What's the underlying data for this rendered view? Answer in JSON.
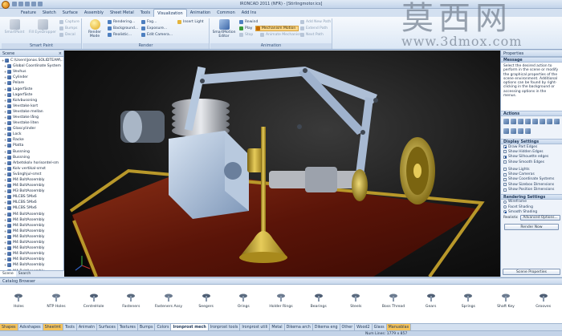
{
  "window": {
    "title": "IRONCAD 2011 (NFR) - [Stirlingmotor.ics]"
  },
  "tabs": [
    "Feature",
    "Sketch",
    "Surface",
    "Assembly",
    "Sheet Metal",
    "Tools",
    "Visualization",
    "Animation",
    "Common",
    "Add Ins"
  ],
  "active_tab": "Visualization",
  "ribbon": {
    "smart_paint": {
      "label": "Smart Paint",
      "smartpaint": "SmartPaint",
      "fill_eyedropper": "Fill EyeDropper",
      "capture": "Capture",
      "bumps": "Bumps",
      "decal": "Decal"
    },
    "render": {
      "label": "Render",
      "render_mode": "Render Mode",
      "rendering": "Rendering...",
      "background": "Background...",
      "realistic": "Realistic...",
      "fog": "Fog...",
      "exposure": "Exposure...",
      "edit_camera": "Edit Camera...",
      "insert_light": "Insert Light"
    },
    "animation": {
      "label": "Animation",
      "smartmotion_editor": "SmartMotion Editor",
      "rewind": "Rewind",
      "play": "Play",
      "stop": "Stop",
      "mechanism_motion": "Mechanism Motion",
      "animate_mechanism": "Animate Mechanism",
      "add_new_path": "Add New Path",
      "extend_path": "Extend Path",
      "next_path": "Next Path"
    }
  },
  "watermark": {
    "chinese": "莫西网",
    "url": "www.3dmox.com"
  },
  "scene_browser": {
    "title": "Scene",
    "close": "×",
    "items": [
      "C:\\Users\\Jonas.SOLIDTEAM\\...",
      "Global Coordinate System",
      "Vevhus",
      "Cylinder",
      "Pelare",
      "Lagerfäste",
      "Lagerfäste",
      "Kolvbussning",
      "Vevstake kort",
      "Vevstake mellan",
      "Vevstake lång",
      "Vevstake liten",
      "Glascylinder",
      "Lock",
      "Racke",
      "Platta",
      "Bussning",
      "Bussning",
      "Arbetskolv horisontel-sm",
      "Kolv vertikal-smst",
      "Svänghjul-smst",
      "M4 BoltAssembly",
      "M4 BoltAssembly",
      "M3 BoltAssembly",
      "MLCBS 5Mx6",
      "MLCBS 5Mx6",
      "MLCBS 5Mx6",
      "M4 BoltAssembly",
      "M4 BoltAssembly",
      "M4 BoltAssembly",
      "M4 BoltAssembly",
      "M4 BoltAssembly",
      "M4 BoltAssembly",
      "M4 BoltAssembly",
      "M4 BoltAssembly",
      "M4 BoltAssembly",
      "M4 BoltAssembly",
      "M4 BoltAssembly"
    ],
    "bottom_tabs": [
      "Scene",
      "Search"
    ]
  },
  "properties": {
    "title": "Properties",
    "message_head": "Message",
    "message": "Select the desired action to perform in the scene or modify the graphical properties of the scene environment. Additional options can be found by right-clicking in the background or accessing options in the menus.",
    "actions_head": "Actions",
    "display_head": "Display Settings",
    "display": [
      {
        "label": "Draw Part Edges",
        "checked": true
      },
      {
        "label": "Show Hidden Edges",
        "checked": false
      },
      {
        "label": "Show Silhouette edges",
        "checked": true
      },
      {
        "label": "Show Smooth Edges",
        "checked": false
      }
    ],
    "display2": [
      {
        "label": "Show Lights",
        "checked": false
      },
      {
        "label": "Show Cameras",
        "checked": false
      },
      {
        "label": "Show Coordinate Systems",
        "checked": false
      },
      {
        "label": "Show Sizebox Dimensions",
        "checked": false
      },
      {
        "label": "Show Position Dimensions",
        "checked": false
      }
    ],
    "rendering_head": "Rendering Settings",
    "rendering": [
      {
        "label": "Wireframe",
        "checked": false
      },
      {
        "label": "Facet Shading",
        "checked": false
      },
      {
        "label": "Smooth Shading",
        "checked": true
      }
    ],
    "realistic_label": "Realistic",
    "advanced_options": "Advanced Options...",
    "render_now": "Render Now",
    "scene_properties": "Scene Properties"
  },
  "catalog": {
    "title": "Catalog Browser",
    "items": [
      "Holes",
      "NTP Holes",
      "CentreHole",
      "Fasteners",
      "Fasteners Assy",
      "Seegers",
      "Orings",
      "Holder Rings",
      "Bearings",
      "Steels",
      "Boss Thread",
      "Gears",
      "Springs",
      "Shaft Key",
      "Grooves"
    ]
  },
  "bottom_tabs": [
    {
      "label": "Shapes",
      "style": "hot"
    },
    {
      "label": "Advshapes",
      "style": ""
    },
    {
      "label": "Sheetmt",
      "style": "hot"
    },
    {
      "label": "Tools",
      "style": ""
    },
    {
      "label": "Animatn",
      "style": ""
    },
    {
      "label": "Surfaces",
      "style": ""
    },
    {
      "label": "Textures",
      "style": ""
    },
    {
      "label": "Bumps",
      "style": ""
    },
    {
      "label": "Colors",
      "style": ""
    },
    {
      "label": "Ironprost mech",
      "style": "sel"
    },
    {
      "label": "Ironprost tools",
      "style": ""
    },
    {
      "label": "Ironprost utili",
      "style": ""
    },
    {
      "label": "Metal",
      "style": ""
    },
    {
      "label": "Dikema arch",
      "style": ""
    },
    {
      "label": "Dikema eng",
      "style": ""
    },
    {
      "label": "Other",
      "style": ""
    },
    {
      "label": "Wood2",
      "style": ""
    },
    {
      "label": "Glass",
      "style": ""
    },
    {
      "label": "Manusblas",
      "style": "hot"
    }
  ],
  "status": {
    "text": "Num Lines: 1779 x 857"
  },
  "colors": {
    "brass": "#c8a42e",
    "steel_blue": "#9fb8d6",
    "wood": "#6b1e10",
    "ribbon_bg": "#e7eef8"
  }
}
